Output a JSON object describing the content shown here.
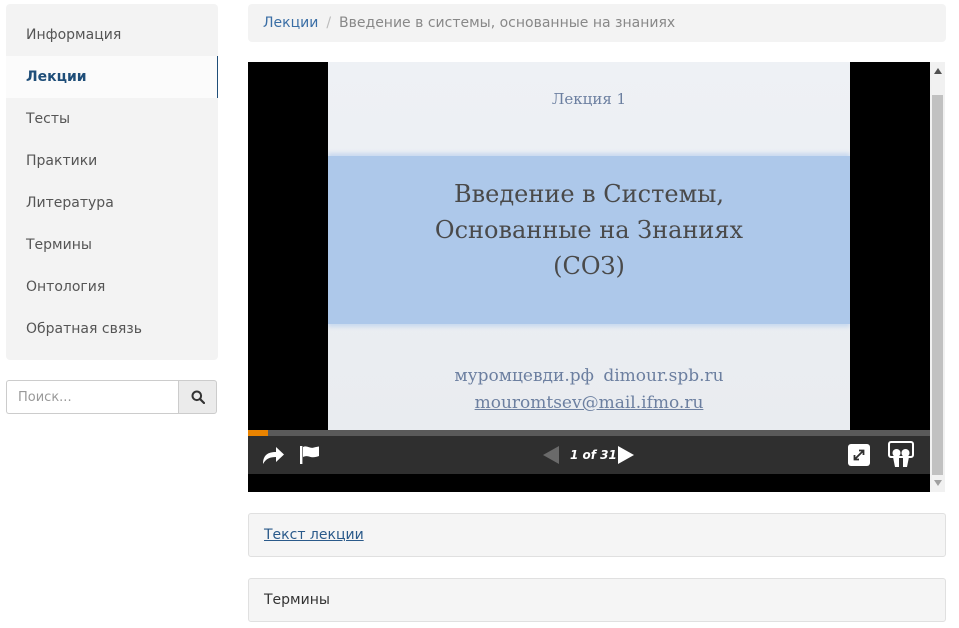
{
  "sidebar": {
    "items": [
      {
        "label": "Информация"
      },
      {
        "label": "Лекции",
        "active": true
      },
      {
        "label": "Тесты"
      },
      {
        "label": "Практики"
      },
      {
        "label": "Литература"
      },
      {
        "label": "Термины"
      },
      {
        "label": "Онтология"
      },
      {
        "label": "Обратная связь"
      }
    ]
  },
  "search": {
    "placeholder": "Поиск...",
    "icon": "search-icon"
  },
  "breadcrumb": {
    "link": "Лекции",
    "separator": "/",
    "current": "Введение в системы, основанные на знаниях"
  },
  "player": {
    "slide": {
      "kicker": "Лекция 1",
      "title_lines": [
        "Введение в Системы,",
        "Основанные на Знаниях",
        "(СОЗ)"
      ],
      "sites": "муромцевди.рф   dimour.spb.ru",
      "email": "mouromtsev@mail.ifmo.ru"
    },
    "progress": 0.03,
    "pager": "1 of 31",
    "icons": [
      "share-icon",
      "flag-icon",
      "prev-icon",
      "next-icon",
      "fullscreen-icon",
      "slideshare-logo-icon"
    ],
    "accent": "#e98300"
  },
  "panels": {
    "lecture_text": "Текст лекции",
    "terms": "Термины"
  }
}
